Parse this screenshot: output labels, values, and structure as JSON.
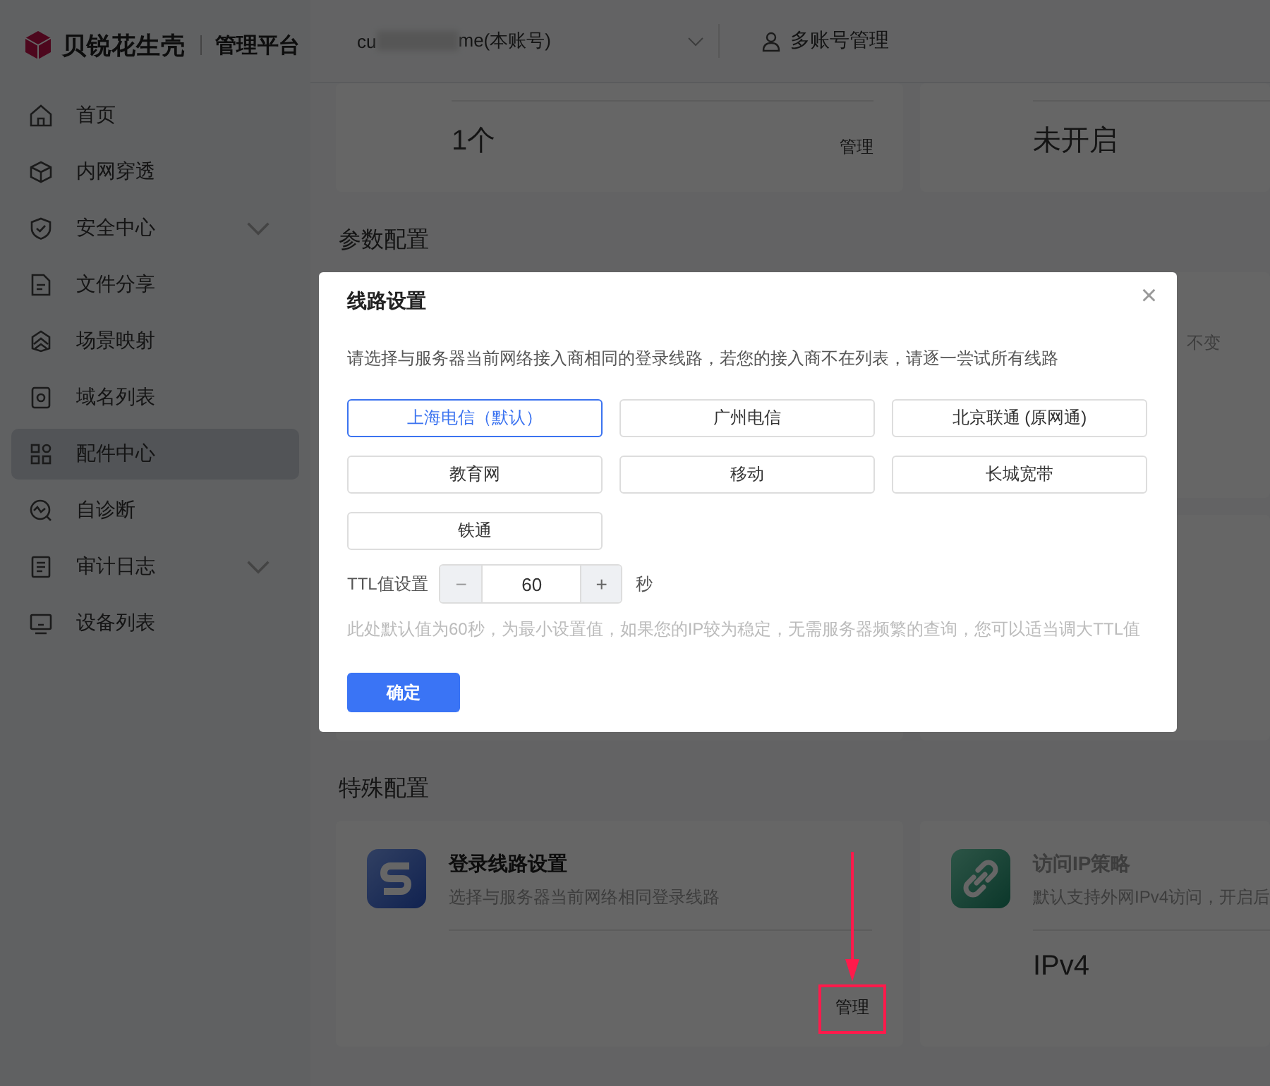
{
  "brand": {
    "name": "贝锐花生壳",
    "product": "管理平台"
  },
  "header": {
    "account_prefix": "cu",
    "account_suffix": "me(本账号)",
    "multi_account": "多账号管理"
  },
  "sidebar": {
    "items": [
      {
        "label": "首页",
        "selected": false,
        "expandable": false
      },
      {
        "label": "内网穿透",
        "selected": false,
        "expandable": false
      },
      {
        "label": "安全中心",
        "selected": false,
        "expandable": true
      },
      {
        "label": "文件分享",
        "selected": false,
        "expandable": false
      },
      {
        "label": "场景映射",
        "selected": false,
        "expandable": false
      },
      {
        "label": "域名列表",
        "selected": false,
        "expandable": false
      },
      {
        "label": "配件中心",
        "selected": true,
        "expandable": false
      },
      {
        "label": "自诊断",
        "selected": false,
        "expandable": false
      },
      {
        "label": "审计日志",
        "selected": false,
        "expandable": true
      },
      {
        "label": "设备列表",
        "selected": false,
        "expandable": false
      }
    ]
  },
  "top_cards": [
    {
      "value": "1个",
      "action": "管理"
    },
    {
      "value": "未开启"
    }
  ],
  "param_section": {
    "title": "参数配置",
    "visible_text": "不变"
  },
  "special_section": {
    "title": "特殊配置",
    "cards": [
      {
        "title": "登录线路设置",
        "description": "选择与服务器当前网络相同登录线路",
        "action": "管理",
        "highlighted": true,
        "muted": false
      },
      {
        "title": "访问IP策略",
        "description": "默认支持外网IPv4访问，开启后",
        "value": "IPv4",
        "muted": true
      }
    ]
  },
  "dialog": {
    "title": "线路设置",
    "close": "×",
    "description": "请选择与服务器当前网络接入商相同的登录线路，若您的接入商不在列表，请逐一尝试所有线路",
    "lines": [
      {
        "label": "上海电信（默认）",
        "selected": true
      },
      {
        "label": "广州电信",
        "selected": false
      },
      {
        "label": "北京联通 (原网通)",
        "selected": false
      },
      {
        "label": "教育网",
        "selected": false
      },
      {
        "label": "移动",
        "selected": false
      },
      {
        "label": "长城宽带",
        "selected": false
      },
      {
        "label": "铁通",
        "selected": false
      }
    ],
    "ttl": {
      "label": "TTL值设置",
      "minus": "−",
      "value": "60",
      "plus": "+",
      "unit": "秒"
    },
    "hint": "此处默认值为60秒，为最小设置值，如果您的IP较为稳定，无需服务器频繁的查询，您可以适当调大TTL值",
    "confirm": "确定"
  }
}
